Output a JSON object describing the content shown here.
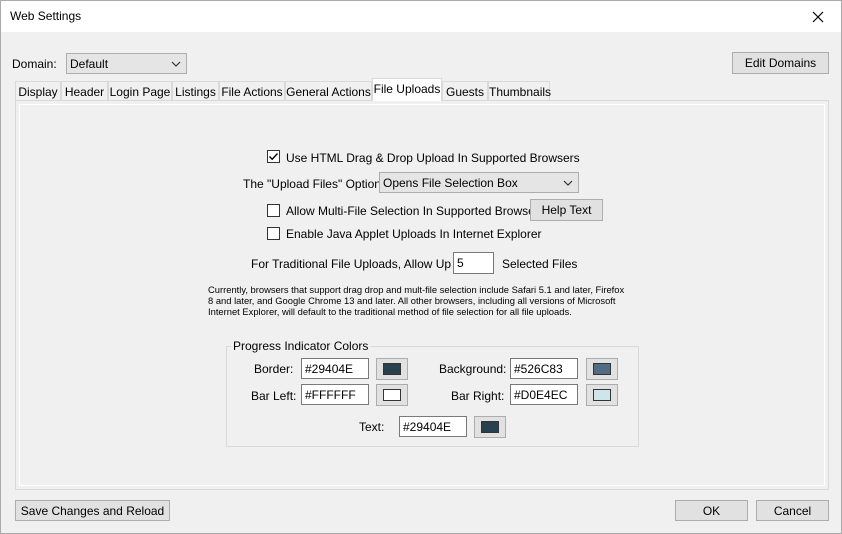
{
  "window": {
    "title": "Web Settings"
  },
  "domain": {
    "label": "Domain:",
    "selected": "Default",
    "edit_button": "Edit Domains"
  },
  "tabs": [
    {
      "label": "Display"
    },
    {
      "label": "Header"
    },
    {
      "label": "Login Page"
    },
    {
      "label": "Listings"
    },
    {
      "label": "File Actions"
    },
    {
      "label": "General Actions"
    },
    {
      "label": "File Uploads"
    },
    {
      "label": "Guests"
    },
    {
      "label": "Thumbnails"
    }
  ],
  "active_tab": "File Uploads",
  "uploads": {
    "drag_drop": {
      "label": "Use HTML Drag & Drop Upload In Supported Browsers",
      "checked": true
    },
    "upload_option": {
      "label": "The \"Upload Files\" Option:",
      "selected": "Opens File Selection Box"
    },
    "multi_file": {
      "label": "Allow Multi-File Selection In Supported Browsers",
      "checked": false
    },
    "help_button": "Help Text",
    "java_applet": {
      "label": "Enable Java Applet Uploads In Internet Explorer",
      "checked": false
    },
    "traditional": {
      "prefix": "For Traditional File Uploads, Allow Up To",
      "value": "5",
      "suffix": "Selected Files"
    },
    "description": "Currently, browsers that support drag  drop and mult-file selection include Safari 5.1 and later, Firefox 8 and later, and Google Chrome 13 and later. All other browsers, including all versions of Microsoft Internet Explorer, will default to the traditional method of file selection for all file uploads."
  },
  "progress_colors": {
    "title": "Progress Indicator Colors",
    "border": {
      "label": "Border:",
      "value": "#29404E",
      "swatch": "#29404E"
    },
    "background": {
      "label": "Background:",
      "value": "#526C83",
      "swatch": "#526C83"
    },
    "bar_left": {
      "label": "Bar Left:",
      "value": "#FFFFFF",
      "swatch": "#FFFFFF"
    },
    "bar_right": {
      "label": "Bar Right:",
      "value": "#D0E4EC",
      "swatch": "#D0E4EC"
    },
    "text": {
      "label": "Text:",
      "value": "#29404E",
      "swatch": "#29404E"
    }
  },
  "footer": {
    "save_reload": "Save Changes and Reload",
    "ok": "OK",
    "cancel": "Cancel"
  }
}
